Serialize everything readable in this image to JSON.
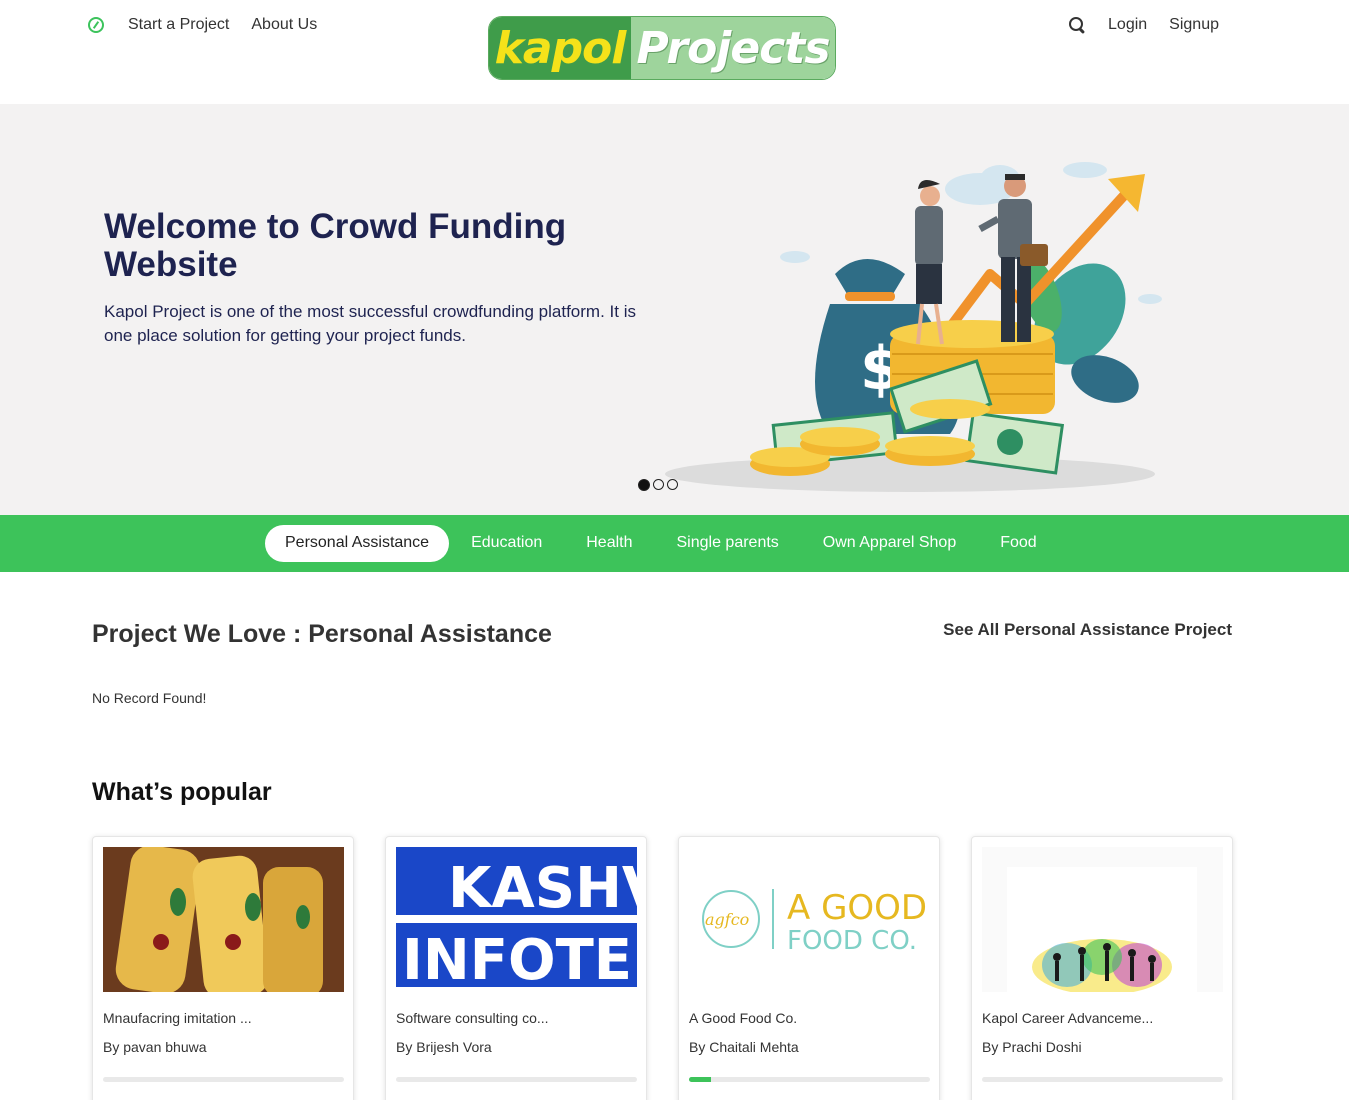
{
  "header": {
    "nav_left": [
      "Start a Project",
      "About Us"
    ],
    "logo_part1": "kapol",
    "logo_part2": "Projects",
    "nav_right": [
      "Login",
      "Signup"
    ]
  },
  "hero": {
    "title": "Welcome to Crowd Funding Website",
    "text": "Kapol Project is one of the most successful crowdfunding platform. It is one place solution for getting your project funds.",
    "slides": 3,
    "active_slide": 1
  },
  "categories": [
    "Personal Assistance",
    "Education",
    "Health",
    "Single parents",
    "Own Apparel Shop",
    "Food"
  ],
  "active_category": "Personal Assistance",
  "section": {
    "title": "Project We Love : Personal Assistance",
    "see_all": "See All Personal Assistance Project",
    "empty_text": "No Record Found!"
  },
  "popular": {
    "title": "What’s popular",
    "cards": [
      {
        "title": "Mnaufacring imitation ...",
        "by": "By pavan bhuwa",
        "progress": 0
      },
      {
        "title": "Software consulting co...",
        "by": "By Brijesh Vora",
        "progress": 0,
        "image_text": [
          "KASHV",
          "INFOTE"
        ]
      },
      {
        "title": "A Good Food Co.",
        "by": "By Chaitali Mehta",
        "progress": 0.09,
        "image_text": [
          "agfco",
          "A GOOD",
          "FOOD CO."
        ]
      },
      {
        "title": "Kapol Career Advanceme...",
        "by": "By Prachi Doshi",
        "progress": 0
      }
    ]
  },
  "colors": {
    "accent_green": "#3dc35a",
    "hero_bg": "#f3f2f2",
    "heading_navy": "#1e2350"
  }
}
